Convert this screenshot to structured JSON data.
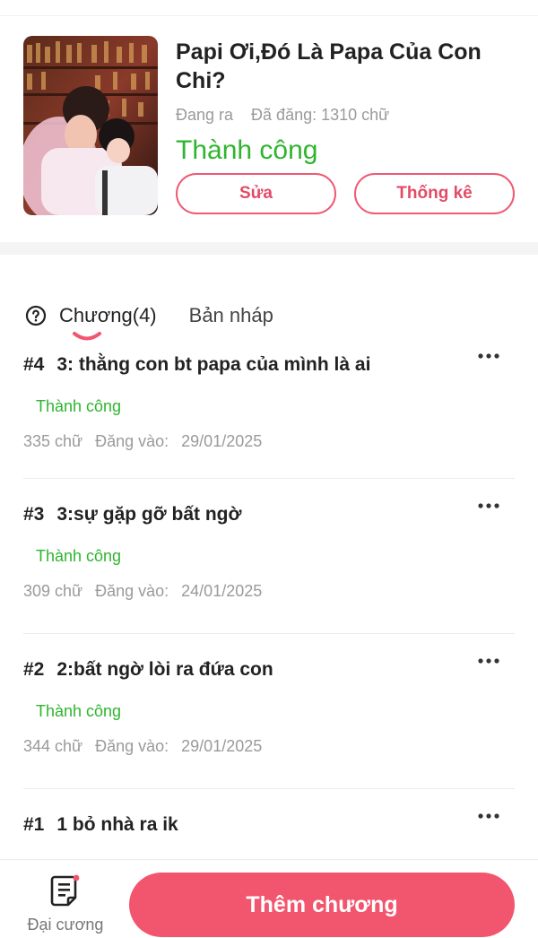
{
  "book": {
    "title": "Papi Ơi,Đó Là Papa Của Con Chi?",
    "status_label": "Đang ra",
    "word_count": "Đã đăng: 1310 chữ",
    "review_status": "Thành công",
    "edit_label": "Sửa",
    "stats_label": "Thống kê"
  },
  "tabs": {
    "chapters": "Chương(4)",
    "drafts": "Bản nháp"
  },
  "chapters": [
    {
      "num": "#4",
      "title": "3: thằng con bt papa của mình là ai",
      "status": "Thành công",
      "words": "335 chữ",
      "date_label": "Đăng vào:",
      "date": "29/01/2025"
    },
    {
      "num": "#3",
      "title": "3:sự gặp gỡ bất ngờ",
      "status": "Thành công",
      "words": "309 chữ",
      "date_label": "Đăng vào:",
      "date": "24/01/2025"
    },
    {
      "num": "#2",
      "title": "2:bất ngờ lòi ra đứa con",
      "status": "Thành công",
      "words": "344 chữ",
      "date_label": "Đăng vào:",
      "date": "29/01/2025"
    },
    {
      "num": "#1",
      "title": "1 bỏ nhà ra ik",
      "status": "",
      "words": "",
      "date_label": "",
      "date": ""
    }
  ],
  "bottom": {
    "outline_label": "Đại cương",
    "add_chapter_label": "Thêm chương"
  },
  "colors": {
    "accent": "#f2566e",
    "success": "#2eb52e",
    "muted": "#9a9a9a"
  }
}
